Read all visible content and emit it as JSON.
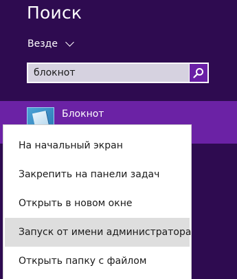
{
  "search": {
    "title": "Поиск",
    "scope_label": "Везде",
    "query": "блокнот"
  },
  "results": [
    {
      "label": "Блокнот",
      "icon": "notepad-app-icon"
    }
  ],
  "context_menu": {
    "items": [
      {
        "label": "На начальный экран"
      },
      {
        "label": "Закрепить на панели задач"
      },
      {
        "label": "Открыть в новом окне"
      },
      {
        "label": "Запуск от имени администратора",
        "highlighted": true
      },
      {
        "label": "Открыть папку с файлом"
      }
    ]
  },
  "colors": {
    "background": "#2e0b50",
    "selected_result": "#6b22a5",
    "search_button": "#6a1fa6",
    "menu_highlight": "#dedede"
  }
}
